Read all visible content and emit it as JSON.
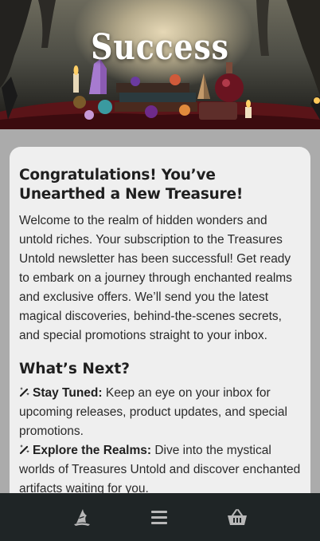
{
  "hero": {
    "title": "Success",
    "image_description_icon": "mystic-crystals-banner"
  },
  "card": {
    "heading": "Congratulations! You’ve Unearthed a New Treasure!",
    "intro": "Welcome to the realm of hidden wonders and untold riches. Your subscription to the Treasures Untold newsletter has been successful! Get ready to embark on a journey through enchanted realms and exclusive offers. We’ll send you the latest magical discoveries, behind-the-scenes secrets, and special promotions straight to your inbox.",
    "next_heading": "What’s Next?",
    "items": [
      {
        "icon": "magic-wand-icon",
        "label": "Stay Tuned:",
        "text": " Keep an eye on your inbox for upcoming releases, product updates, and special promotions."
      },
      {
        "icon": "magic-wand-icon",
        "label": "Explore the Realms:",
        "text": " Dive into the mystical worlds of Treasures Untold and discover enchanted artifacts waiting for you."
      }
    ]
  },
  "nav": {
    "items": [
      {
        "icon": "wizard-hat-icon"
      },
      {
        "icon": "menu-icon"
      },
      {
        "icon": "basket-icon"
      }
    ]
  },
  "colors": {
    "page_background": "#ababab",
    "card_background": "#efefef",
    "nav_background": "#1f2526",
    "nav_icon": "#b8b8b8",
    "text": "#262626"
  }
}
